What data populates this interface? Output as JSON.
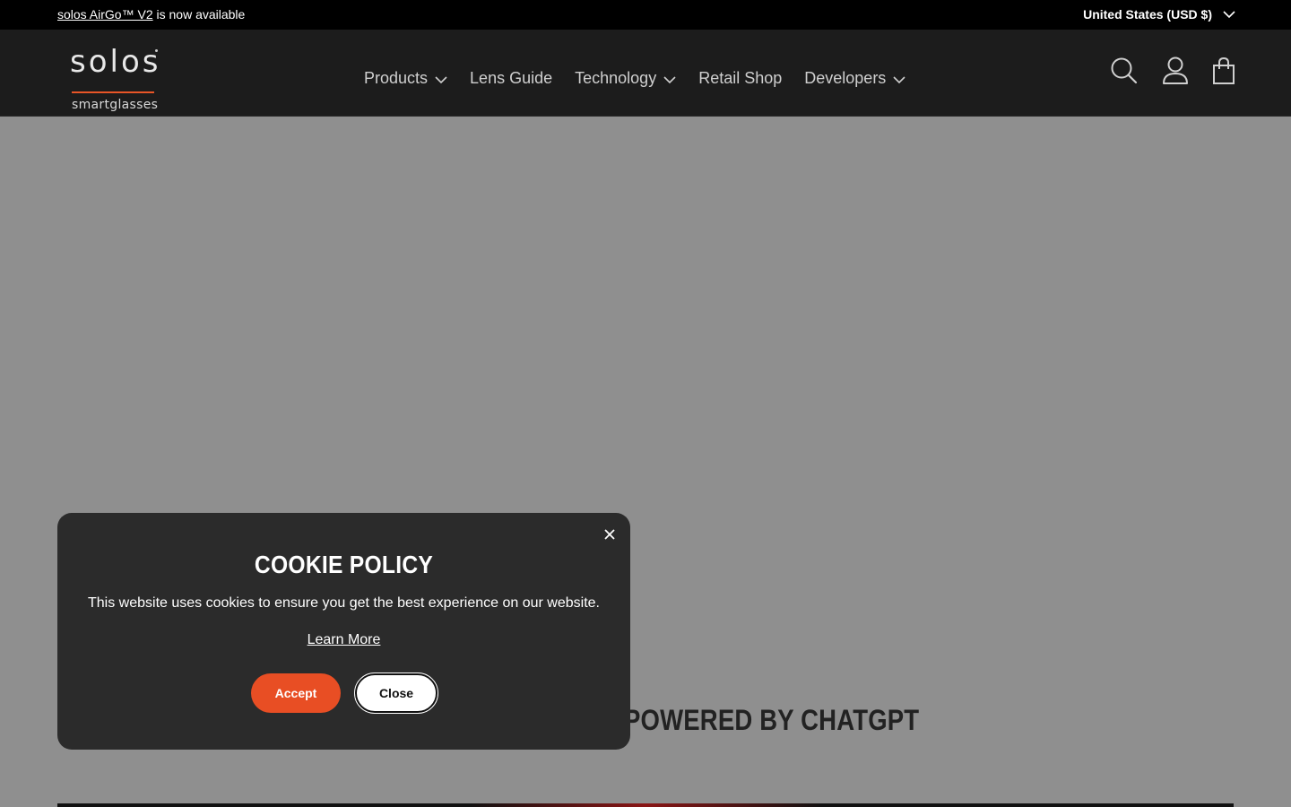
{
  "announcement": {
    "link_text": "solos AirGo™ V2",
    "rest_text": " is now available",
    "currency": "United States (USD $)"
  },
  "logo": {
    "word": "solos",
    "sub": "smartglasses"
  },
  "nav": {
    "products": "Products",
    "lens_guide": "Lens Guide",
    "technology": "Technology",
    "retail_shop": "Retail Shop",
    "developers": "Developers"
  },
  "hero": {
    "heading_partial": "POWERED BY CHATGPT"
  },
  "cookie": {
    "title": "COOKIE POLICY",
    "text": "This website uses cookies to ensure you get the best experience on our website.",
    "learn_more": "Learn More",
    "accept": "Accept",
    "close": "Close"
  },
  "icons": {
    "search": "search-icon",
    "account": "user-icon",
    "cart": "bag-icon",
    "close": "close-icon"
  },
  "colors": {
    "accent": "#e84e24",
    "header_bg": "#1c1c1c",
    "page_bg": "#8f8f8f",
    "popup_bg": "#2b2b2b"
  }
}
